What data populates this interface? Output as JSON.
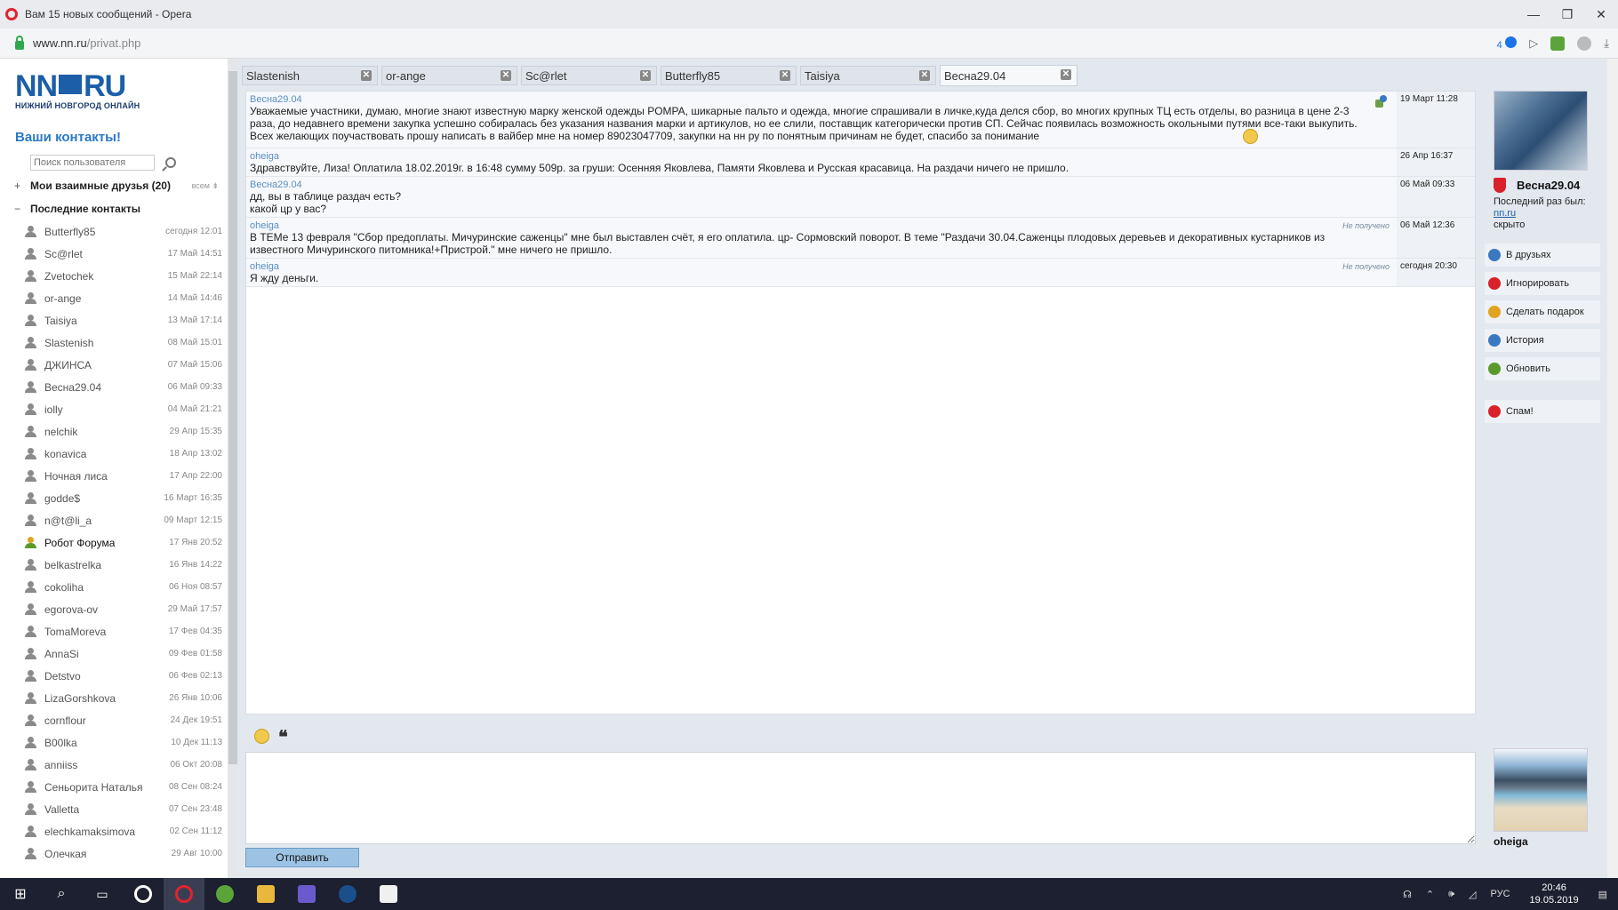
{
  "window": {
    "title": "Вам 15 новых сообщений - Opera"
  },
  "addressbar": {
    "url_host": "www.nn.ru",
    "url_path": "/privat.php",
    "badge": "4"
  },
  "logo": {
    "main": "NN",
    "suffix": "RU",
    "tagline": "НИЖНИЙ НОВГОРОД ОНЛАЙН"
  },
  "sidebar": {
    "title": "Ваши контакты!",
    "search_placeholder": "Поиск пользователя",
    "groups": [
      {
        "toggle": "+",
        "label": "Мои взаимные друзья (20)",
        "all": "всем ⇟"
      },
      {
        "toggle": "−",
        "label": "Последние контакты"
      }
    ],
    "contacts": [
      {
        "name": "Butterfly85",
        "time": "сегодня 12:01"
      },
      {
        "name": "Sc@rlet",
        "time": "17 Май 14:51"
      },
      {
        "name": "Zvetochek",
        "time": "15 Май 22:14"
      },
      {
        "name": "or-ange",
        "time": "14 Май 14:46"
      },
      {
        "name": "Taisiya",
        "time": "13 Май 17:14"
      },
      {
        "name": "Slastenish",
        "time": "08 Май 15:01"
      },
      {
        "name": "ДЖИНСА",
        "time": "07 Май 15:06"
      },
      {
        "name": "Весна29.04",
        "time": "06 Май 09:33"
      },
      {
        "name": "iolly",
        "time": "04 Май 21:21"
      },
      {
        "name": "nelchik",
        "time": "29 Апр 15:35"
      },
      {
        "name": "konavica",
        "time": "18 Апр 13:02"
      },
      {
        "name": "Ночная лиса",
        "time": "17 Апр 22:00"
      },
      {
        "name": "godde$",
        "time": "16 Март 16:35"
      },
      {
        "name": "n@t@li_a",
        "time": "09 Март 12:15"
      },
      {
        "name": "Робот Форума",
        "time": "17 Янв 20:52",
        "online": true
      },
      {
        "name": "belkastrelka",
        "time": "16 Янв 14:22"
      },
      {
        "name": "cokoliha",
        "time": "06 Ноя 08:57"
      },
      {
        "name": "egorova-ov",
        "time": "29 Май 17:57"
      },
      {
        "name": "TomaMoreva",
        "time": "17 Фев 04:35"
      },
      {
        "name": "AnnaSi",
        "time": "09 Фев 01:58"
      },
      {
        "name": "Detstvo",
        "time": "06 Фев 02:13"
      },
      {
        "name": "LizaGorshkova",
        "time": "26 Янв 10:06"
      },
      {
        "name": "cornflour",
        "time": "24 Дек 19:51"
      },
      {
        "name": "B00lka",
        "time": "10 Дек 11:13"
      },
      {
        "name": "anniiss",
        "time": "06 Окт 20:08"
      },
      {
        "name": "Сеньорита Наталья",
        "time": "08 Сен 08:24"
      },
      {
        "name": "Valletta",
        "time": "07 Сен 23:48"
      },
      {
        "name": "elechkamaksimova",
        "time": "02 Сен 11:12"
      },
      {
        "name": "Олечкая",
        "time": "29 Авг 10:00"
      }
    ]
  },
  "tabs": [
    {
      "label": "Slastenish"
    },
    {
      "label": "or-ange"
    },
    {
      "label": "Sc@rlet"
    },
    {
      "label": "Butterfly85"
    },
    {
      "label": "Taisiya"
    },
    {
      "label": "Весна29.04",
      "active": true
    }
  ],
  "messages": [
    {
      "author": "Весна29.04",
      "time": "19 Март 11:28",
      "status": "",
      "text": "Уважаемые участники, думаю, многие знают известную марку женской одежды POMPA, шикарные пальто и одежда, многие спрашивали в личке,куда делся сбор, во многих крупных ТЦ есть отделы, во разница в цене 2-3 раза, до недавнего времени закупка успешно собиралась без указания названия марки и артикулов, но ее слили, поставщик категорически против СП. Сейчас появилась возможность окольными путями все-таки выкупить. Всех желающих поучаствовать прошу написать в вайбер мне на номер 89023047709, закупки на нн ру по понятным причинам не будет, спасибо за понимание"
    },
    {
      "author": "oheiga",
      "time": "26 Апр 16:37",
      "status": "",
      "text": "Здравствуйте, Лиза! Оплатила 18.02.2019г. в 16:48 сумму 509р. за груши: Осенняя Яковлева, Памяти Яковлева и Русская красавица. На раздачи ничего не пришло."
    },
    {
      "author": "Весна29.04",
      "time": "06 Май 09:33",
      "status": "",
      "text": "дд, вы в таблице раздач есть?\nкакой цр у вас?"
    },
    {
      "author": "oheiga",
      "time": "06 Май 12:36",
      "status": "Не получено",
      "text": "В ТЕМе 13 февраля \"Сбор предоплаты. Мичуринские саженцы\" мне был выставлен счёт, я его оплатила. цр- Сормовский поворот. В теме \"Раздачи 30.04.Саженцы плодовых деревьев и декоративных кустарников из известного Мичуринского питомника!+Пристрой.\" мне ничего не пришло."
    },
    {
      "author": "oheiga",
      "time": "сегодня 20:30",
      "status": "Не получено",
      "text": "Я жду деньги."
    }
  ],
  "profile": {
    "name": "Весна29.04",
    "last_seen_label": "Последний раз был:",
    "last_seen_site": "nn.ru",
    "last_seen_value": "скрыто",
    "actions": [
      {
        "label": "В друзьях",
        "icon": "person-icon",
        "color": "#3b78c2"
      },
      {
        "label": "Игнорировать",
        "icon": "block-icon",
        "color": "#d8212a"
      },
      {
        "label": "Сделать подарок",
        "icon": "gift-icon",
        "color": "#e0a420"
      },
      {
        "label": "История",
        "icon": "history-icon",
        "color": "#3b78c2"
      },
      {
        "label": "Обновить",
        "icon": "refresh-icon",
        "color": "#5a9a2a"
      }
    ],
    "spam_label": "Спам!"
  },
  "compose": {
    "send_label": "Отправить",
    "quote_glyph": "❝"
  },
  "me": {
    "name": "oheiga"
  },
  "taskbar": {
    "lang": "РУС",
    "time": "20:46",
    "date": "19.05.2019"
  }
}
